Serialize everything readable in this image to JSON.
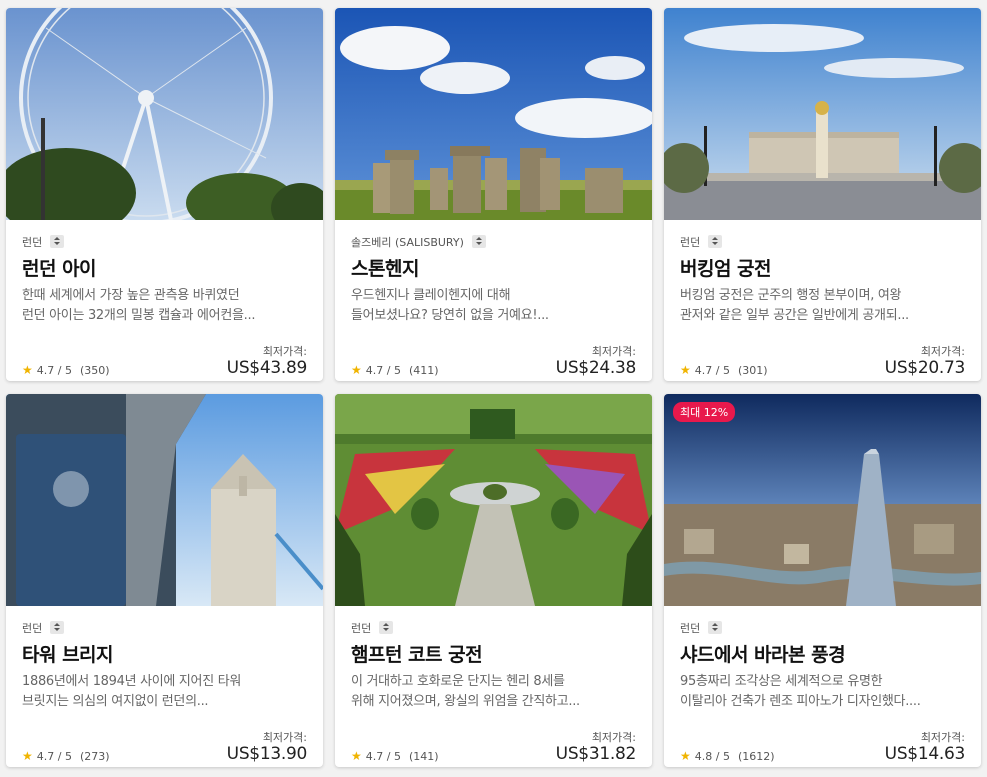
{
  "cards": [
    {
      "location": "런던",
      "title": "런던 아이",
      "desc1": "한때 세계에서 가장 높은 관측용 바퀴였던",
      "desc2": "런던 아이는 32개의 밀봉 캡슐과 에어컨을...",
      "rating": "4.7",
      "rating_max": "/ 5",
      "reviews": "(350)",
      "price_label": "최저가격:",
      "price": "US$43.89",
      "badge": ""
    },
    {
      "location": "솔즈베리 (SALISBURY)",
      "title": "스톤헨지",
      "desc1": "우드헨지나 클레이헨지에 대해",
      "desc2": "들어보셨나요? 당연히 없을 거예요!...",
      "rating": "4.7",
      "rating_max": "/ 5",
      "reviews": "(411)",
      "price_label": "최저가격:",
      "price": "US$24.38",
      "badge": ""
    },
    {
      "location": "런던",
      "title": "버킹엄 궁전",
      "desc1": "버킹엄 궁전은 군주의 행정 본부이며, 여왕",
      "desc2": "관저와 같은 일부 공간은 일반에게 공개되...",
      "rating": "4.7",
      "rating_max": "/ 5",
      "reviews": "(301)",
      "price_label": "최저가격:",
      "price": "US$20.73",
      "badge": ""
    },
    {
      "location": "런던",
      "title": "타워 브리지",
      "desc1": "1886년에서 1894년 사이에 지어진 타워",
      "desc2": "브릿지는 의심의 여지없이 런던의...",
      "rating": "4.7",
      "rating_max": "/ 5",
      "reviews": "(273)",
      "price_label": "최저가격:",
      "price": "US$13.90",
      "badge": ""
    },
    {
      "location": "런던",
      "title": "햄프턴 코트 궁전",
      "desc1": "이 거대하고 호화로운 단지는 헨리 8세를",
      "desc2": "위해 지어졌으며, 왕실의 위엄을 간직하고...",
      "rating": "4.7",
      "rating_max": "/ 5",
      "reviews": "(141)",
      "price_label": "최저가격:",
      "price": "US$31.82",
      "badge": ""
    },
    {
      "location": "런던",
      "title": "샤드에서 바라본 풍경",
      "desc1": "95층짜리 조각상은 세계적으로 유명한",
      "desc2": "이탈리아 건축가 렌조 피아노가 디자인했다....",
      "rating": "4.8",
      "rating_max": "/ 5",
      "reviews": "(1612)",
      "price_label": "최저가격:",
      "price": "US$14.63",
      "badge": "최대 12%"
    }
  ],
  "colors": {
    "star": "#f0b400",
    "badge": "#e8194c"
  },
  "icons": {
    "rating": "star-icon",
    "sort": "sort-arrows-icon"
  }
}
